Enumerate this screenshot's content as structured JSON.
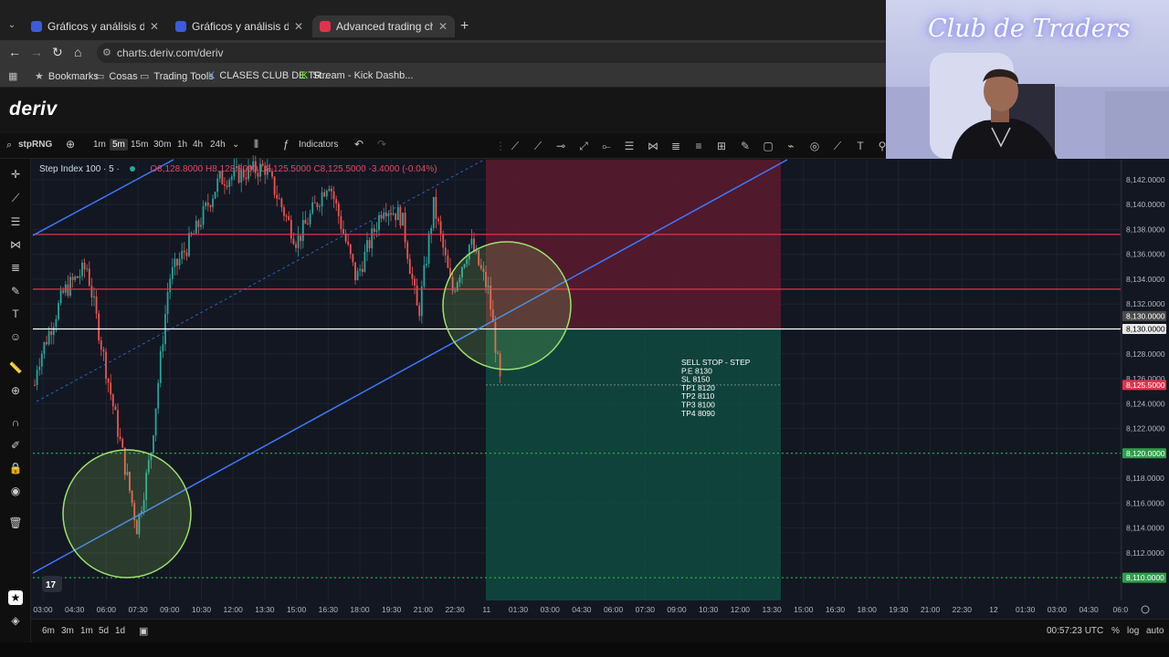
{
  "browser": {
    "tabs": [
      {
        "title": "Gráficos y análisis de TradingVi",
        "active": false
      },
      {
        "title": "Gráficos y análisis de TradingVi",
        "active": false
      },
      {
        "title": "Advanced trading charts & tools",
        "active": true
      }
    ],
    "url": "charts.deriv.com/deriv",
    "bookmarks_label": "Bookmarks",
    "bookmarks": [
      "Cosas",
      "Trading Tools",
      "CLASES CLUB DE TR...",
      "Stream - Kick Dashb..."
    ]
  },
  "app": {
    "logo": "deriv"
  },
  "toolbar": {
    "symbol": "stpRNG",
    "intervals": [
      "1m",
      "5m",
      "15m",
      "30m",
      "1h",
      "4h",
      "24h"
    ],
    "selected_interval": "5m",
    "indicators_label": "Indicators"
  },
  "chart": {
    "title": "Step Index 100 · 5 ·",
    "ohlc": "O8,128.8000 H8,128.8000 L8,125.5000 C8,125.5000 -3.4000 (-0.04%)",
    "annotation_lines": [
      "SELL STOP - STEP",
      "P.E 8130",
      "SL 8150",
      "TP1 8120",
      "TP2 8110",
      "TP3 8100",
      "TP4 8090"
    ],
    "price_ticks": [
      "8,142.0000",
      "8,140.0000",
      "8,138.0000",
      "8,136.0000",
      "8,134.0000",
      "8,132.0000",
      "8,130.0000",
      "8,128.0000",
      "8,126.0000",
      "8,124.0000",
      "8,122.0000",
      "8,120.0000",
      "8,118.0000",
      "8,116.0000",
      "8,114.0000",
      "8,112.0000",
      "8,110.0000"
    ],
    "price_tick_values": [
      8142,
      8140,
      8138,
      8136,
      8134,
      8132,
      8130,
      8128,
      8126,
      8124,
      8122,
      8120,
      8118,
      8116,
      8114,
      8112,
      8110
    ],
    "price_labels": [
      {
        "text": "8,130.0000",
        "value": 8130.3,
        "color": "#4a4a4a"
      },
      {
        "text": "8,130.0000",
        "value": 8130.0,
        "color": "#e8e8e8"
      },
      {
        "text": "8,125.5000",
        "value": 8125.5,
        "color": "#e0334d"
      },
      {
        "text": "8,120.0000",
        "value": 8120.0,
        "color": "#2e9e4a"
      },
      {
        "text": "8,110.0000",
        "value": 8110.0,
        "color": "#2e9e4a"
      }
    ],
    "time_ticks": [
      "03:00",
      "04:30",
      "06:00",
      "07:30",
      "09:00",
      "10:30",
      "12:00",
      "13:30",
      "15:00",
      "16:30",
      "18:00",
      "19:30",
      "21:00",
      "22:30",
      "11",
      "01:30",
      "03:00",
      "04:30",
      "06:00",
      "07:30",
      "09:00",
      "10:30",
      "12:00",
      "13:30",
      "15:00",
      "16:30",
      "18:00",
      "19:30",
      "21:00",
      "22:30",
      "12",
      "01:30",
      "03:00",
      "04:30",
      "06:0"
    ],
    "levels": {
      "entry": 8130,
      "sl_line": 8133.2,
      "sl_top": 8137.6,
      "tp1": 8120,
      "tp2": 8110
    },
    "colors": {
      "bull": "#26a69a",
      "bear": "#ef5350",
      "stop_zone": "#5c1a2e",
      "target_zone": "#0f4a40",
      "trendline": "#3d7bff",
      "circle": "#9be36b"
    }
  },
  "bottom": {
    "ranges": [
      "6m",
      "3m",
      "1m",
      "5d",
      "1d"
    ],
    "clock": "00:57:23 UTC",
    "opts": [
      "%",
      "log",
      "auto"
    ]
  },
  "webcam": {
    "brand": "Club de Traders"
  }
}
